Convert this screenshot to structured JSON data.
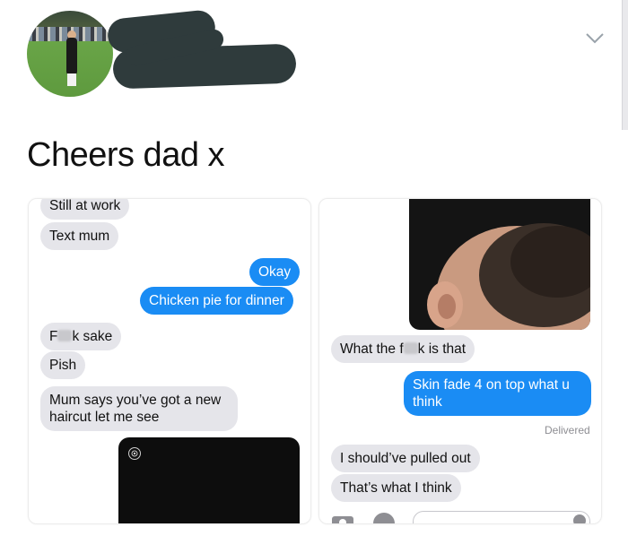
{
  "header": {
    "avatar_icon": "profile-photo-footballer",
    "redaction_icon": "scribble-redaction",
    "chevron_icon": "chevron-down-icon"
  },
  "post": {
    "caption": "Cheers dad x"
  },
  "left_chat": {
    "messages": [
      {
        "from": "them",
        "text": "Still at work"
      },
      {
        "from": "them",
        "text": "Text mum"
      },
      {
        "from": "me",
        "text": "Okay"
      },
      {
        "from": "me",
        "text": "Chicken pie for dinner"
      },
      {
        "from": "them",
        "pre": "F",
        "post": "k sake"
      },
      {
        "from": "them",
        "text": "Pish"
      },
      {
        "from": "them",
        "text": "Mum says you’ve got a new haircut let me see"
      }
    ]
  },
  "right_chat": {
    "messages": [
      {
        "from": "them",
        "pre": "What the f",
        "post": "k is that"
      },
      {
        "from": "me",
        "text": "Skin fade 4 on top what u think"
      },
      {
        "from": "them",
        "text": "I should’ve pulled out"
      },
      {
        "from": "them",
        "text": "That’s what I think"
      }
    ],
    "status": "Delivered"
  },
  "colors": {
    "blue_bubble": "#1a8cf4",
    "grey_bubble": "#e5e5ea",
    "redaction": "#2f3b3c"
  }
}
